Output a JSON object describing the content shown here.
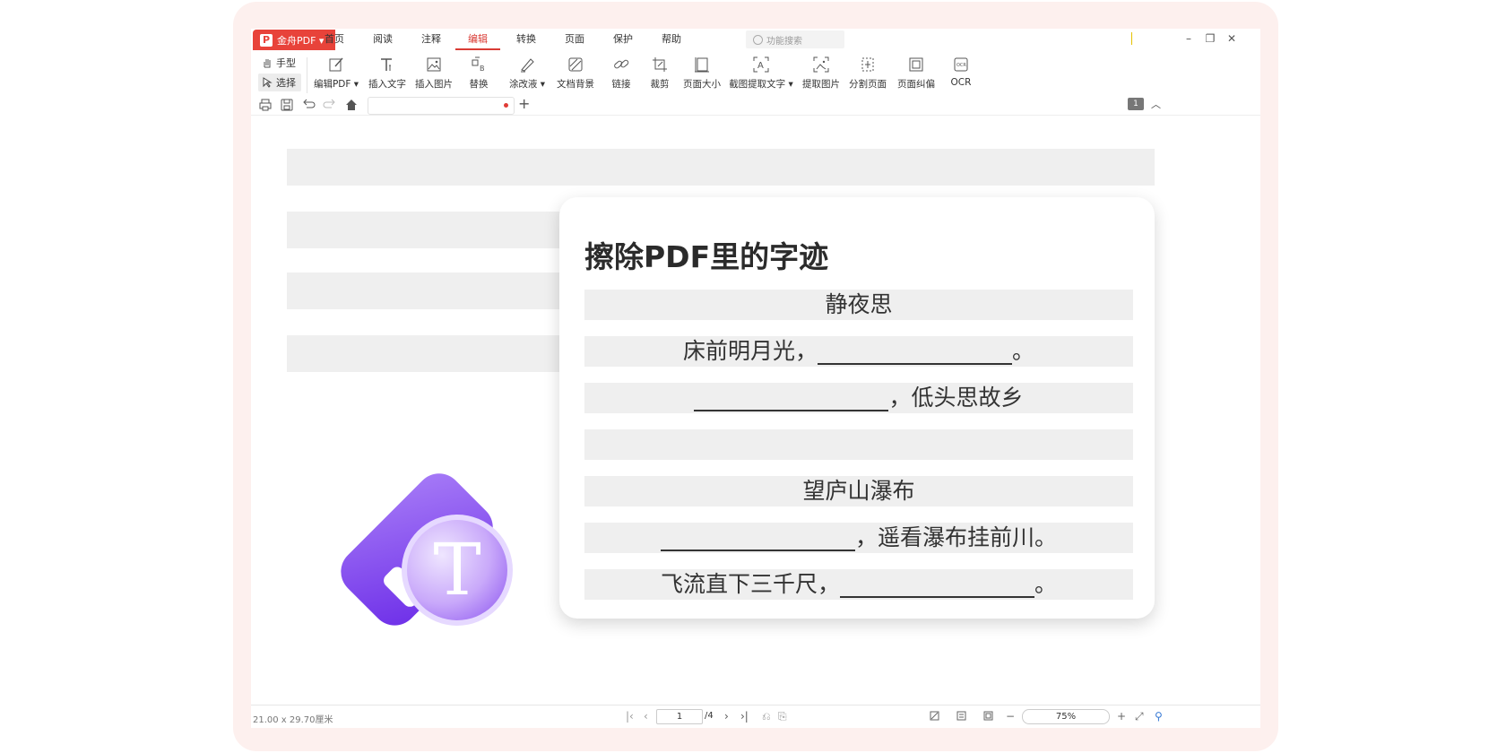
{
  "app": {
    "brand_label": "金舟PDF ▾",
    "brand_logo_letter": "P"
  },
  "menu": {
    "items": [
      "首页",
      "阅读",
      "注释",
      "编辑",
      "转换",
      "页面",
      "保护",
      "帮助"
    ],
    "active": "编辑",
    "search_placeholder": "功能搜索"
  },
  "ribbon": {
    "hand_label": "手型",
    "select_label": "选择",
    "tools": [
      {
        "label": "编辑PDF ▾",
        "icon": "edit-pdf-icon"
      },
      {
        "label": "插入文字",
        "icon": "insert-text-icon"
      },
      {
        "label": "插入图片",
        "icon": "insert-image-icon"
      },
      {
        "label": "替换",
        "icon": "replace-icon"
      },
      {
        "label": "涂改液 ▾",
        "icon": "correction-fluid-icon"
      },
      {
        "label": "文档背景",
        "icon": "document-background-icon"
      },
      {
        "label": "链接",
        "icon": "link-icon"
      },
      {
        "label": "裁剪",
        "icon": "crop-icon"
      },
      {
        "label": "页面大小",
        "icon": "page-size-icon"
      },
      {
        "label": "截图提取文字 ▾",
        "icon": "screenshot-ocr-icon"
      },
      {
        "label": "提取图片",
        "icon": "extract-image-icon"
      },
      {
        "label": "分割页面",
        "icon": "split-page-icon"
      },
      {
        "label": "页面纠偏",
        "icon": "deskew-icon"
      },
      {
        "label": "OCR",
        "icon": "ocr-icon"
      }
    ]
  },
  "quickbar": {
    "page_badge": "1"
  },
  "card": {
    "title": "擦除PDF里的字迹",
    "poem1_title": "静夜思",
    "poem1_line1": "床前明月光，",
    "poem1_line1_end": "。",
    "poem1_line2": "，低头思故乡",
    "poem2_title": "望庐山瀑布",
    "poem2_line1": "，遥看瀑布挂前川。",
    "poem2_line2": "飞流直下三千尺，",
    "poem2_line2_end": "。"
  },
  "illustration": {
    "letter": "T",
    "colors": {
      "purple_dark": "#7a3cf0",
      "purple_light": "#b08af8"
    }
  },
  "status": {
    "page_size": "21.00 x 29.70厘米",
    "current_page": "1",
    "total_pages": "/4",
    "zoom": "75%"
  },
  "colors": {
    "accent": "#e8433a",
    "active_tab": "#d93b35",
    "frame_bg": "#fdf0ee"
  }
}
